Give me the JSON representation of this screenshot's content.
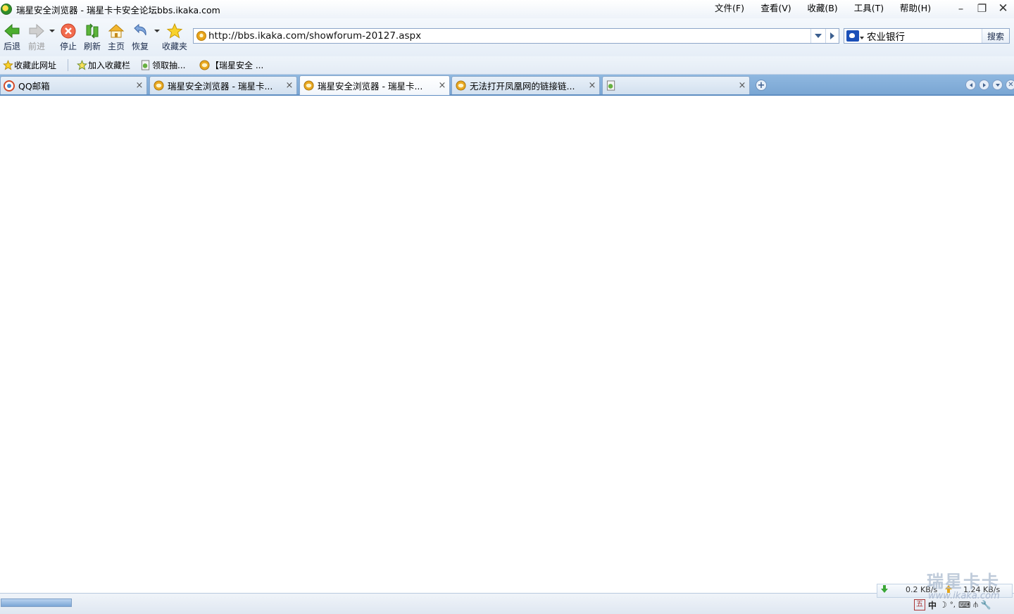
{
  "window": {
    "title": "瑞星安全浏览器 - 瑞星卡卡安全论坛bbs.ikaka.com",
    "minimize": "–",
    "maximize": "❐",
    "close": "✕"
  },
  "menu": [
    {
      "label": "文件(F)"
    },
    {
      "label": "查看(V)"
    },
    {
      "label": "收藏(B)"
    },
    {
      "label": "工具(T)"
    },
    {
      "label": "帮助(H)"
    }
  ],
  "toolbar": {
    "back": "后退",
    "forward": "前进",
    "stop": "停止",
    "refresh": "刷新",
    "home": "主页",
    "restore": "恢复",
    "favorites": "收藏夹"
  },
  "address": {
    "url": "http://bbs.ikaka.com/showforum-20127.aspx"
  },
  "search": {
    "value": "农业银行",
    "button": "搜索"
  },
  "bookmarks": [
    {
      "label": "收藏此网址",
      "icon": "star-icon"
    },
    {
      "label": "加入收藏栏",
      "icon": "star-add-icon"
    },
    {
      "label": "领取抽...",
      "icon": "page-icon"
    },
    {
      "label": "【瑞星安全 ...",
      "icon": "rising-icon"
    }
  ],
  "tabs": [
    {
      "label": "QQ邮箱",
      "close": "×",
      "active": false
    },
    {
      "label": "瑞星安全浏览器 - 瑞星卡...",
      "close": "×",
      "active": false
    },
    {
      "label": "瑞星安全浏览器 - 瑞星卡...",
      "close": "×",
      "active": true
    },
    {
      "label": "无法打开凤凰网的链接链...",
      "close": "×",
      "active": false
    },
    {
      "label": "",
      "close": "×",
      "active": false
    }
  ],
  "status": {
    "download_speed": "0.2 KB/s",
    "upload_speed": "1.24 KB/s",
    "progress": 1.0,
    "watermark": "瑞星卡卡",
    "watermark_url": "www.ikaka.com",
    "ime_mode": "中"
  },
  "colors": {
    "tabstrip": "#7aa6d3",
    "toolbar": "#e6eef7",
    "accent": "#3c5f8f"
  }
}
